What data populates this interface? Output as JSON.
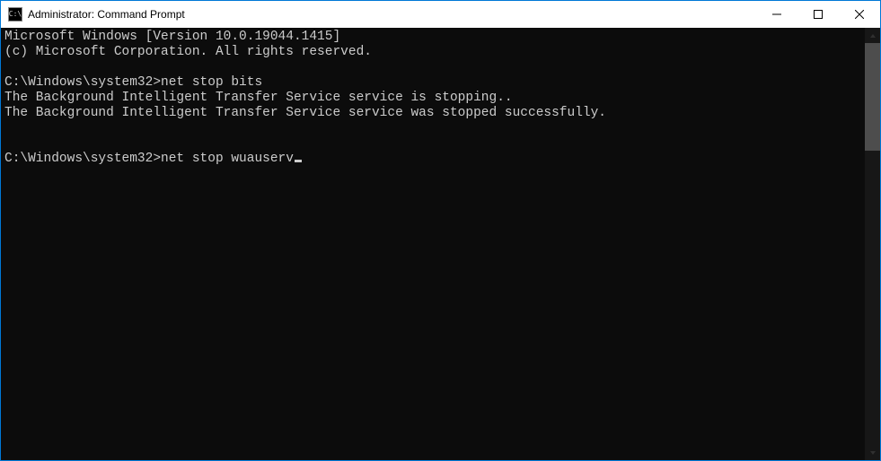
{
  "titlebar": {
    "icon_text": "C:\\",
    "title": "Administrator: Command Prompt"
  },
  "terminal": {
    "line1": "Microsoft Windows [Version 10.0.19044.1415]",
    "line2": "(c) Microsoft Corporation. All rights reserved.",
    "blank1": "",
    "prompt1": "C:\\Windows\\system32>",
    "command1": "net stop bits",
    "output1": "The Background Intelligent Transfer Service service is stopping..",
    "output2": "The Background Intelligent Transfer Service service was stopped successfully.",
    "blank2": "",
    "blank3": "",
    "prompt2": "C:\\Windows\\system32>",
    "command2": "net stop wuauserv"
  }
}
